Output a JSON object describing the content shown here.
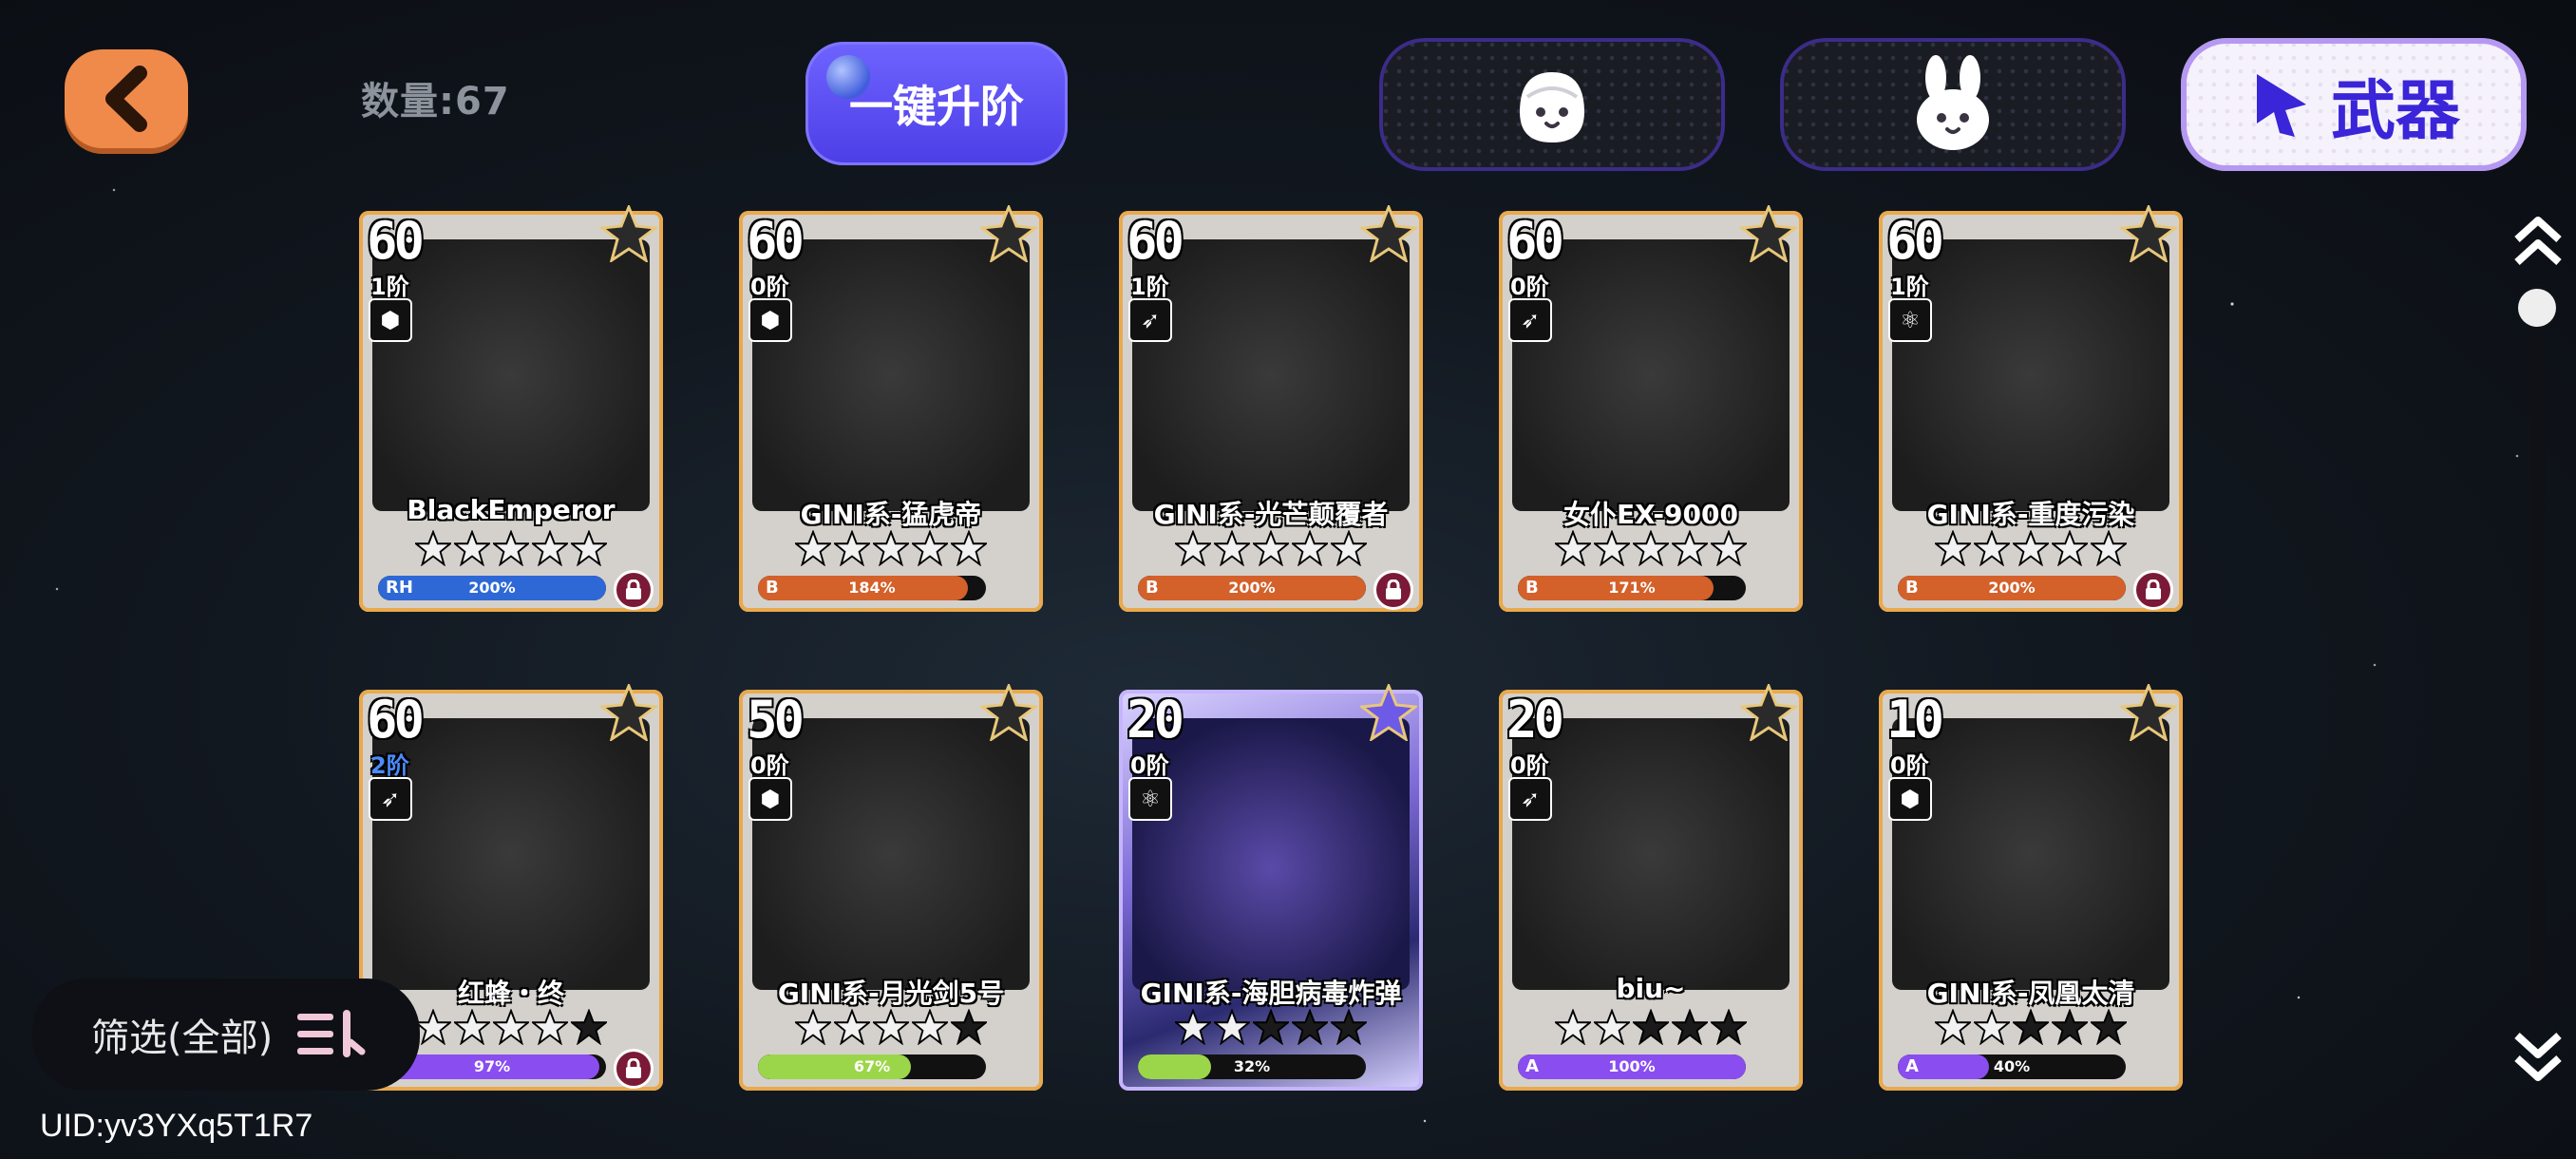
{
  "header": {
    "count_text": "数量:67",
    "upgrade_label": "一键升阶",
    "tabs": [
      {
        "icon": "face-icon",
        "label": "",
        "active": false
      },
      {
        "icon": "bunny-icon",
        "label": "",
        "active": false
      },
      {
        "icon": "rocket-icon",
        "label": "武器",
        "active": true
      }
    ]
  },
  "cards": [
    {
      "level": "60",
      "rank": "1阶",
      "rank_highlight": false,
      "type_icon": "hexagon-icon",
      "name": "BlackEmperor",
      "stars_lit": 5,
      "bar_tag": "RH",
      "bar_color": "#2d68d6",
      "progress": 1.0,
      "pct": "200%",
      "locked": true,
      "corner": "wing-badge-icon",
      "legend": false
    },
    {
      "level": "60",
      "rank": "0阶",
      "rank_highlight": false,
      "type_icon": "hexagon-icon",
      "name": "GINI系-猛虎帝",
      "stars_lit": 5,
      "bar_tag": "B",
      "bar_color": "#d4602a",
      "progress": 0.92,
      "pct": "184%",
      "locked": false,
      "corner": "wing-badge-icon",
      "legend": false
    },
    {
      "level": "60",
      "rank": "1阶",
      "rank_highlight": false,
      "type_icon": "rocket-icon",
      "name": "GINI系-光芒颠覆者",
      "stars_lit": 5,
      "bar_tag": "B",
      "bar_color": "#d4602a",
      "progress": 1.0,
      "pct": "200%",
      "locked": true,
      "corner": "wing-badge-icon",
      "legend": false
    },
    {
      "level": "60",
      "rank": "0阶",
      "rank_highlight": false,
      "type_icon": "rocket-icon",
      "name": "女仆EX-9000",
      "stars_lit": 5,
      "bar_tag": "B",
      "bar_color": "#d4602a",
      "progress": 0.855,
      "pct": "171%",
      "locked": false,
      "corner": "wing-badge-icon",
      "legend": false
    },
    {
      "level": "60",
      "rank": "1阶",
      "rank_highlight": false,
      "type_icon": "atom-icon",
      "name": "GINI系-重度污染",
      "stars_lit": 5,
      "bar_tag": "B",
      "bar_color": "#d4602a",
      "progress": 1.0,
      "pct": "200%",
      "locked": true,
      "corner": "wing-badge-icon",
      "legend": false
    },
    {
      "level": "60",
      "rank": "2阶",
      "rank_highlight": true,
      "type_icon": "rocket-icon",
      "name": "红蜂・终",
      "stars_lit": 4,
      "bar_tag": "",
      "bar_color": "#8a4df0",
      "progress": 0.97,
      "pct": "97%",
      "locked": true,
      "corner": "corner-badge-icon",
      "legend": false
    },
    {
      "level": "50",
      "rank": "0阶",
      "rank_highlight": false,
      "type_icon": "hexagon-icon",
      "name": "GINI系-月光剑5号",
      "stars_lit": 4,
      "bar_tag": "",
      "bar_color": "#9bd64a",
      "progress": 0.67,
      "pct": "67%",
      "locked": false,
      "corner": "wing-badge-icon",
      "legend": false
    },
    {
      "level": "20",
      "rank": "0阶",
      "rank_highlight": false,
      "type_icon": "atom-icon",
      "name": "GINI系-海胆病毒炸弹",
      "stars_lit": 2,
      "bar_tag": "",
      "bar_color": "#9bd64a",
      "progress": 0.32,
      "pct": "32%",
      "locked": false,
      "corner": "legend-badge-icon",
      "legend": true
    },
    {
      "level": "20",
      "rank": "0阶",
      "rank_highlight": false,
      "type_icon": "rocket-icon",
      "name": "biu~",
      "stars_lit": 2,
      "bar_tag": "A",
      "bar_color": "#8a4df0",
      "progress": 1.0,
      "pct": "100%",
      "locked": false,
      "corner": "corner-badge-icon",
      "legend": false
    },
    {
      "level": "10",
      "rank": "0阶",
      "rank_highlight": false,
      "type_icon": "hexagon-icon",
      "name": "GINI系-凤凰太清",
      "stars_lit": 2,
      "bar_tag": "A",
      "bar_color": "#8a4df0",
      "progress": 0.4,
      "pct": "40%",
      "locked": false,
      "corner": "wing-badge-icon",
      "legend": false
    }
  ],
  "filter": {
    "label": "筛选(全部)"
  },
  "footer": {
    "uid": "UID:yv3YXq5T1R7"
  }
}
